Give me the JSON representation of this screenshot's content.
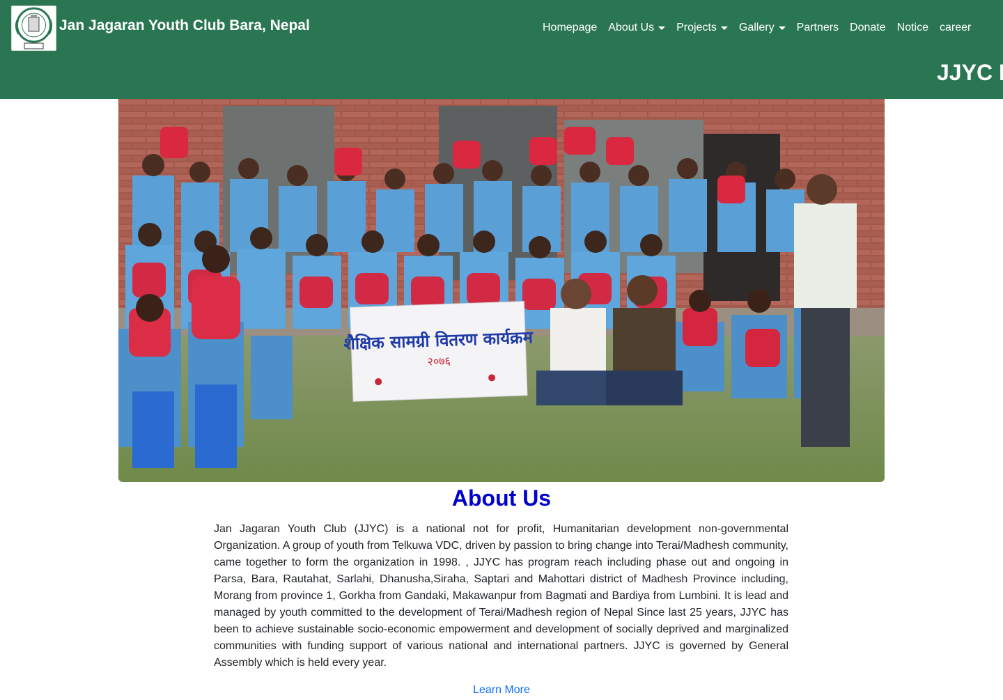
{
  "header": {
    "logo_icon": "jjyc-seal-logo",
    "brand": "Jan Jagaran Youth Club Bara, Nepal",
    "marquee": "JJYC I"
  },
  "nav": {
    "items": [
      {
        "label": "Homepage"
      },
      {
        "label": "About Us"
      },
      {
        "label": "Projects"
      },
      {
        "label": "Gallery"
      },
      {
        "label": "Partners"
      },
      {
        "label": "Donate"
      },
      {
        "label": "Notice"
      },
      {
        "label": "career"
      }
    ]
  },
  "hero": {
    "banner_line1": "शैक्षिक सामग्री वितरण कार्यक्रम",
    "banner_year": "२०७६"
  },
  "about": {
    "title": "About Us",
    "text": "Jan Jagaran Youth Club (JJYC) is a national not for profit, Humanitarian development non-governmental Organization. A group of youth from Telkuwa VDC, driven by passion to bring change into Terai/Madhesh community, came together to form the organization in 1998. , JJYC has program reach including phase out and ongoing in Parsa, Bara, Rautahat, Sarlahi, Dhanusha,Siraha, Saptari and Mahottari district of Madhesh Province including, Morang from province 1, Gorkha from Gandaki, Makawanpur from Bagmati and Bardiya from Lumbini. It is lead and managed by youth committed to the development of Terai/Madhesh region of Nepal Since last 25 years, JJYC has been to achieve sustainable socio-economic empowerment and development of socially deprived and marginalized communities with funding support of various national and international partners. JJYC is governed by General Assembly which is held every year.",
    "learn_more": "Learn More"
  },
  "colors": {
    "navbar_bg": "#2a7652",
    "title_blue": "#0000cc",
    "link_blue": "#0d6efd"
  }
}
